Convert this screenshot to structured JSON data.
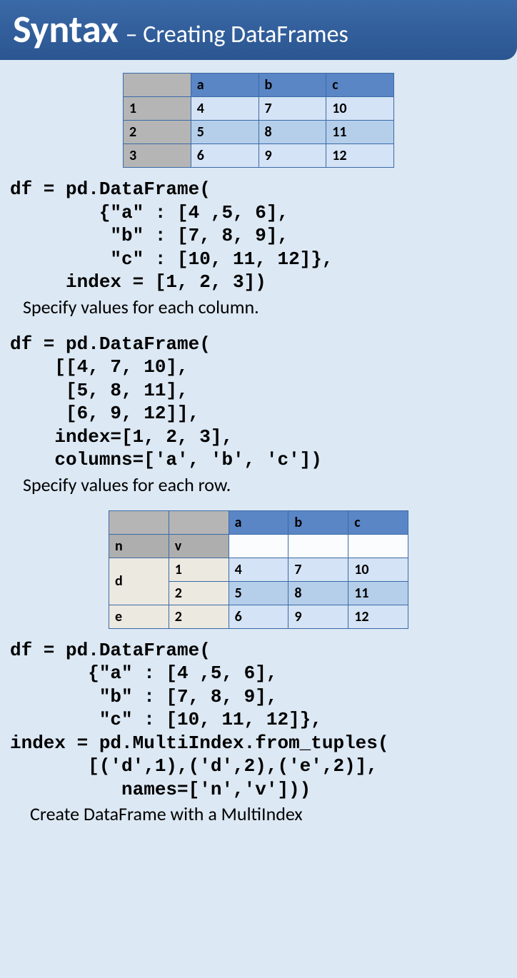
{
  "header": {
    "title": "Syntax",
    "subtitle": "– Creating DataFrames"
  },
  "table1": {
    "cols": [
      "a",
      "b",
      "c"
    ],
    "rows": [
      {
        "idx": "1",
        "vals": [
          "4",
          "7",
          "10"
        ]
      },
      {
        "idx": "2",
        "vals": [
          "5",
          "8",
          "11"
        ]
      },
      {
        "idx": "3",
        "vals": [
          "6",
          "9",
          "12"
        ]
      }
    ]
  },
  "code1": "df = pd.DataFrame(\n        {\"a\" : [4 ,5, 6],\n         \"b\" : [7, 8, 9],\n         \"c\" : [10, 11, 12]},\n     index = [1, 2, 3])",
  "caption1": "Specify values for each column.",
  "code2": "df = pd.DataFrame(\n    [[4, 7, 10],\n     [5, 8, 11],\n     [6, 9, 12]],\n    index=[1, 2, 3],\n    columns=['a', 'b', 'c'])",
  "caption2": "Specify values for each row.",
  "table2": {
    "cols": [
      "a",
      "b",
      "c"
    ],
    "index_names": [
      "n",
      "v"
    ],
    "rows": [
      {
        "n": "d",
        "v": "1",
        "vals": [
          "4",
          "7",
          "10"
        ]
      },
      {
        "n": "d",
        "v": "2",
        "vals": [
          "5",
          "8",
          "11"
        ]
      },
      {
        "n": "e",
        "v": "2",
        "vals": [
          "6",
          "9",
          "12"
        ]
      }
    ]
  },
  "code3": "df = pd.DataFrame(\n       {\"a\" : [4 ,5, 6],\n        \"b\" : [7, 8, 9],\n        \"c\" : [10, 11, 12]},\nindex = pd.MultiIndex.from_tuples(\n       [('d',1),('d',2),('e',2)],\n          names=['n','v']))",
  "caption3": "Create DataFrame with a MultiIndex"
}
